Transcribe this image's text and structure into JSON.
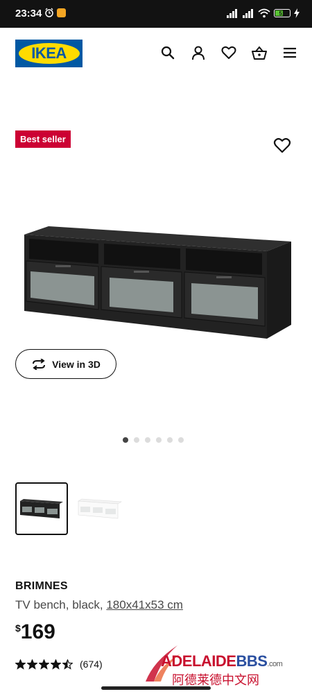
{
  "status_bar": {
    "time": "23:34",
    "battery": "51",
    "icons": [
      "alarm-icon",
      "app-notification-icon",
      "signal-icon",
      "hd-signal-icon",
      "wifi-icon",
      "battery-icon",
      "charging-icon"
    ]
  },
  "header": {
    "logo": "IKEA",
    "nav_icons": [
      "search-icon",
      "profile-icon",
      "heart-icon",
      "basket-icon",
      "menu-icon"
    ]
  },
  "product": {
    "badge": "Best seller",
    "view_3d_label": "View in 3D",
    "name": "BRIMNES",
    "desc_prefix": "TV bench, black, ",
    "dimensions": "180x41x53 cm",
    "price_currency": "$",
    "price_value": "169",
    "rating_value": 4.5,
    "rating_max": 5,
    "review_count": "(674)"
  },
  "gallery": {
    "dot_count": 6,
    "active_index": 0,
    "thumbnails": [
      "black TV bench",
      "white TV bench"
    ]
  },
  "watermark": {
    "brand_main": "ADELAIDE",
    "brand_bbs": "BBS",
    "brand_suffix": ".com",
    "brand_chinese": "阿德莱德中文网"
  },
  "colors": {
    "ikea_blue": "#0058a3",
    "ikea_yellow": "#ffdb00",
    "badge_red": "#cc0033"
  }
}
